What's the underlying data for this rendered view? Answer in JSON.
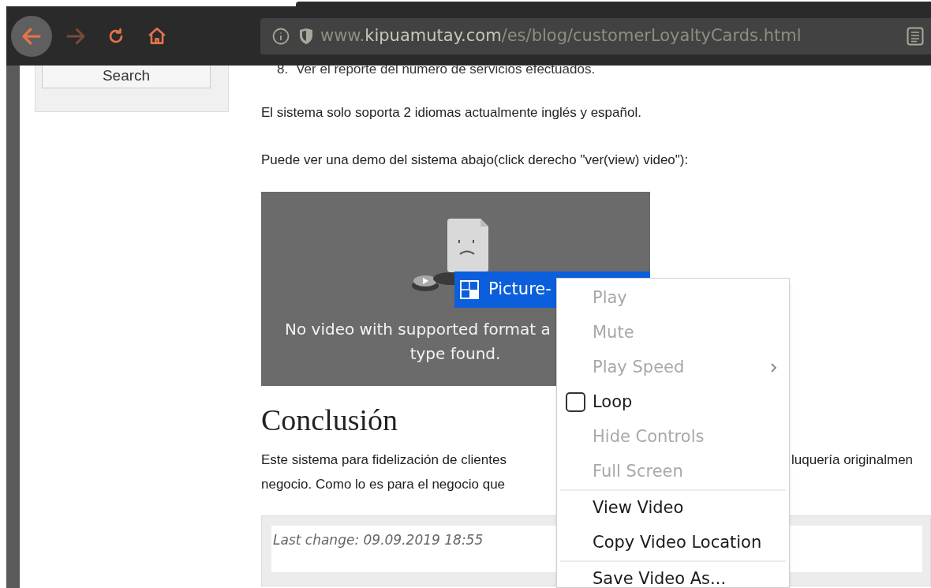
{
  "toolbar": {
    "back": {
      "disabled": false
    },
    "forward": {
      "disabled": true
    },
    "url": {
      "prefix": "www.",
      "domain": "kipuamutay.com",
      "path": "/es/blog/customerLoyaltyCards.html"
    }
  },
  "sidebar": {
    "search_button": "Search"
  },
  "article": {
    "list_item": {
      "number": "8.",
      "text": "Ver el reporte del número de servicios efectuados."
    },
    "paragraphs": [
      "El sistema solo soporta 2 idiomas actualmente inglés y español.",
      "Puede ver una demo del sistema abajo(click derecho \"ver(view) video\"):"
    ],
    "video": {
      "message_lines": [
        "No video with supported format a",
        "type found."
      ],
      "pip_button": "Picture-"
    },
    "heading": "Conclusión",
    "conclusion_lines": [
      {
        "left": "Este sistema para fidelización de clientes",
        "right": "luquería originalmen"
      },
      {
        "left": "negocio. Como lo es para el negocio que"
      }
    ],
    "last_change": "Last change: 09.09.2019 18:55"
  },
  "context_menu": [
    {
      "kind": "action",
      "label": "Play",
      "disabled": true
    },
    {
      "kind": "action",
      "label": "Mute",
      "disabled": true
    },
    {
      "kind": "submenu",
      "label": "Play Speed",
      "disabled": true
    },
    {
      "kind": "checkbox",
      "label": "Loop",
      "disabled": false,
      "checked": false
    },
    {
      "kind": "action",
      "label": "Hide Controls",
      "disabled": true
    },
    {
      "kind": "action",
      "label": "Full Screen",
      "disabled": true
    },
    {
      "kind": "separator"
    },
    {
      "kind": "action",
      "label": "View Video",
      "disabled": false
    },
    {
      "kind": "action",
      "label": "Copy Video Location",
      "disabled": false
    },
    {
      "kind": "separator"
    },
    {
      "kind": "action",
      "label": "Save Video As...",
      "disabled": false
    }
  ]
}
